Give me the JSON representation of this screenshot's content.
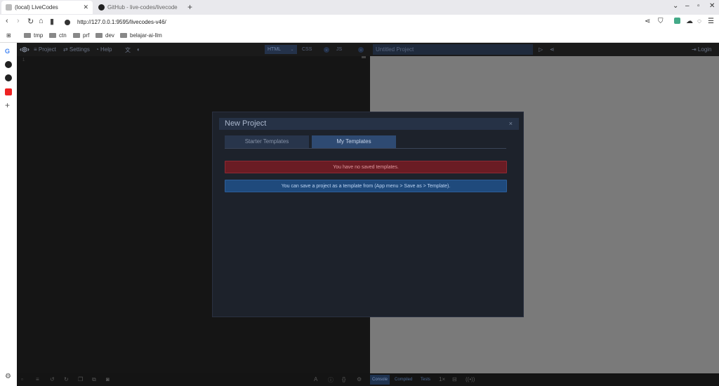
{
  "browser": {
    "tabs": [
      {
        "label": "(local) LiveCodes",
        "active": true
      },
      {
        "label": "GitHub - live-codes/livecodes",
        "active": false
      }
    ],
    "new_tab": "+",
    "url": "http://127.0.0.1:9595/livecodes-v46/",
    "bookmarks": [
      "tmp",
      "ctn",
      "prf",
      "dev",
      "belajar-ai-llm"
    ]
  },
  "app": {
    "toolbar": {
      "project": "≡ Project",
      "settings": "⇄ Settings",
      "help": "◔ Help",
      "editors": [
        "HTML",
        "CSS",
        "JS"
      ]
    },
    "result": {
      "title": "Untitled Project",
      "login": "⇥ Login"
    },
    "editor": {
      "line": "1"
    },
    "statusbar": {
      "console_tabs": [
        "Console",
        "Compiled",
        "Tests"
      ],
      "zoom": "1×"
    }
  },
  "modal": {
    "title": "New Project",
    "close": "×",
    "tabs": [
      "Starter Templates",
      "My Templates"
    ],
    "active_tab": "My Templates",
    "error_message": "You have no saved templates.",
    "info_message": "You can save a project as a template from (App menu > Save as > Template)."
  },
  "colors": {
    "accent": "#2e4a72",
    "error_bg": "#6a1c24",
    "info_bg": "#1f4a7c"
  }
}
